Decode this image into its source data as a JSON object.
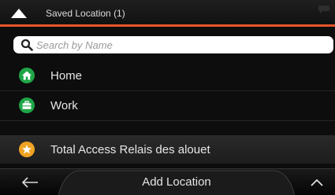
{
  "header": {
    "title": "Saved Location (1)",
    "accent_color": "#e8542c"
  },
  "search": {
    "value": "",
    "placeholder": "Search by Name"
  },
  "items": [
    {
      "label": "Home",
      "icon": "home-icon",
      "icon_color": "#1fa547"
    },
    {
      "label": "Work",
      "icon": "briefcase-icon",
      "icon_color": "#1fa547"
    },
    {
      "label": "Total Access Relais des alouet",
      "icon": "star-icon",
      "icon_color": "#f0a323"
    }
  ],
  "footer": {
    "add_label": "Add Location",
    "back_icon": "arrow-left-icon",
    "up_icon": "chevron-up-icon"
  }
}
